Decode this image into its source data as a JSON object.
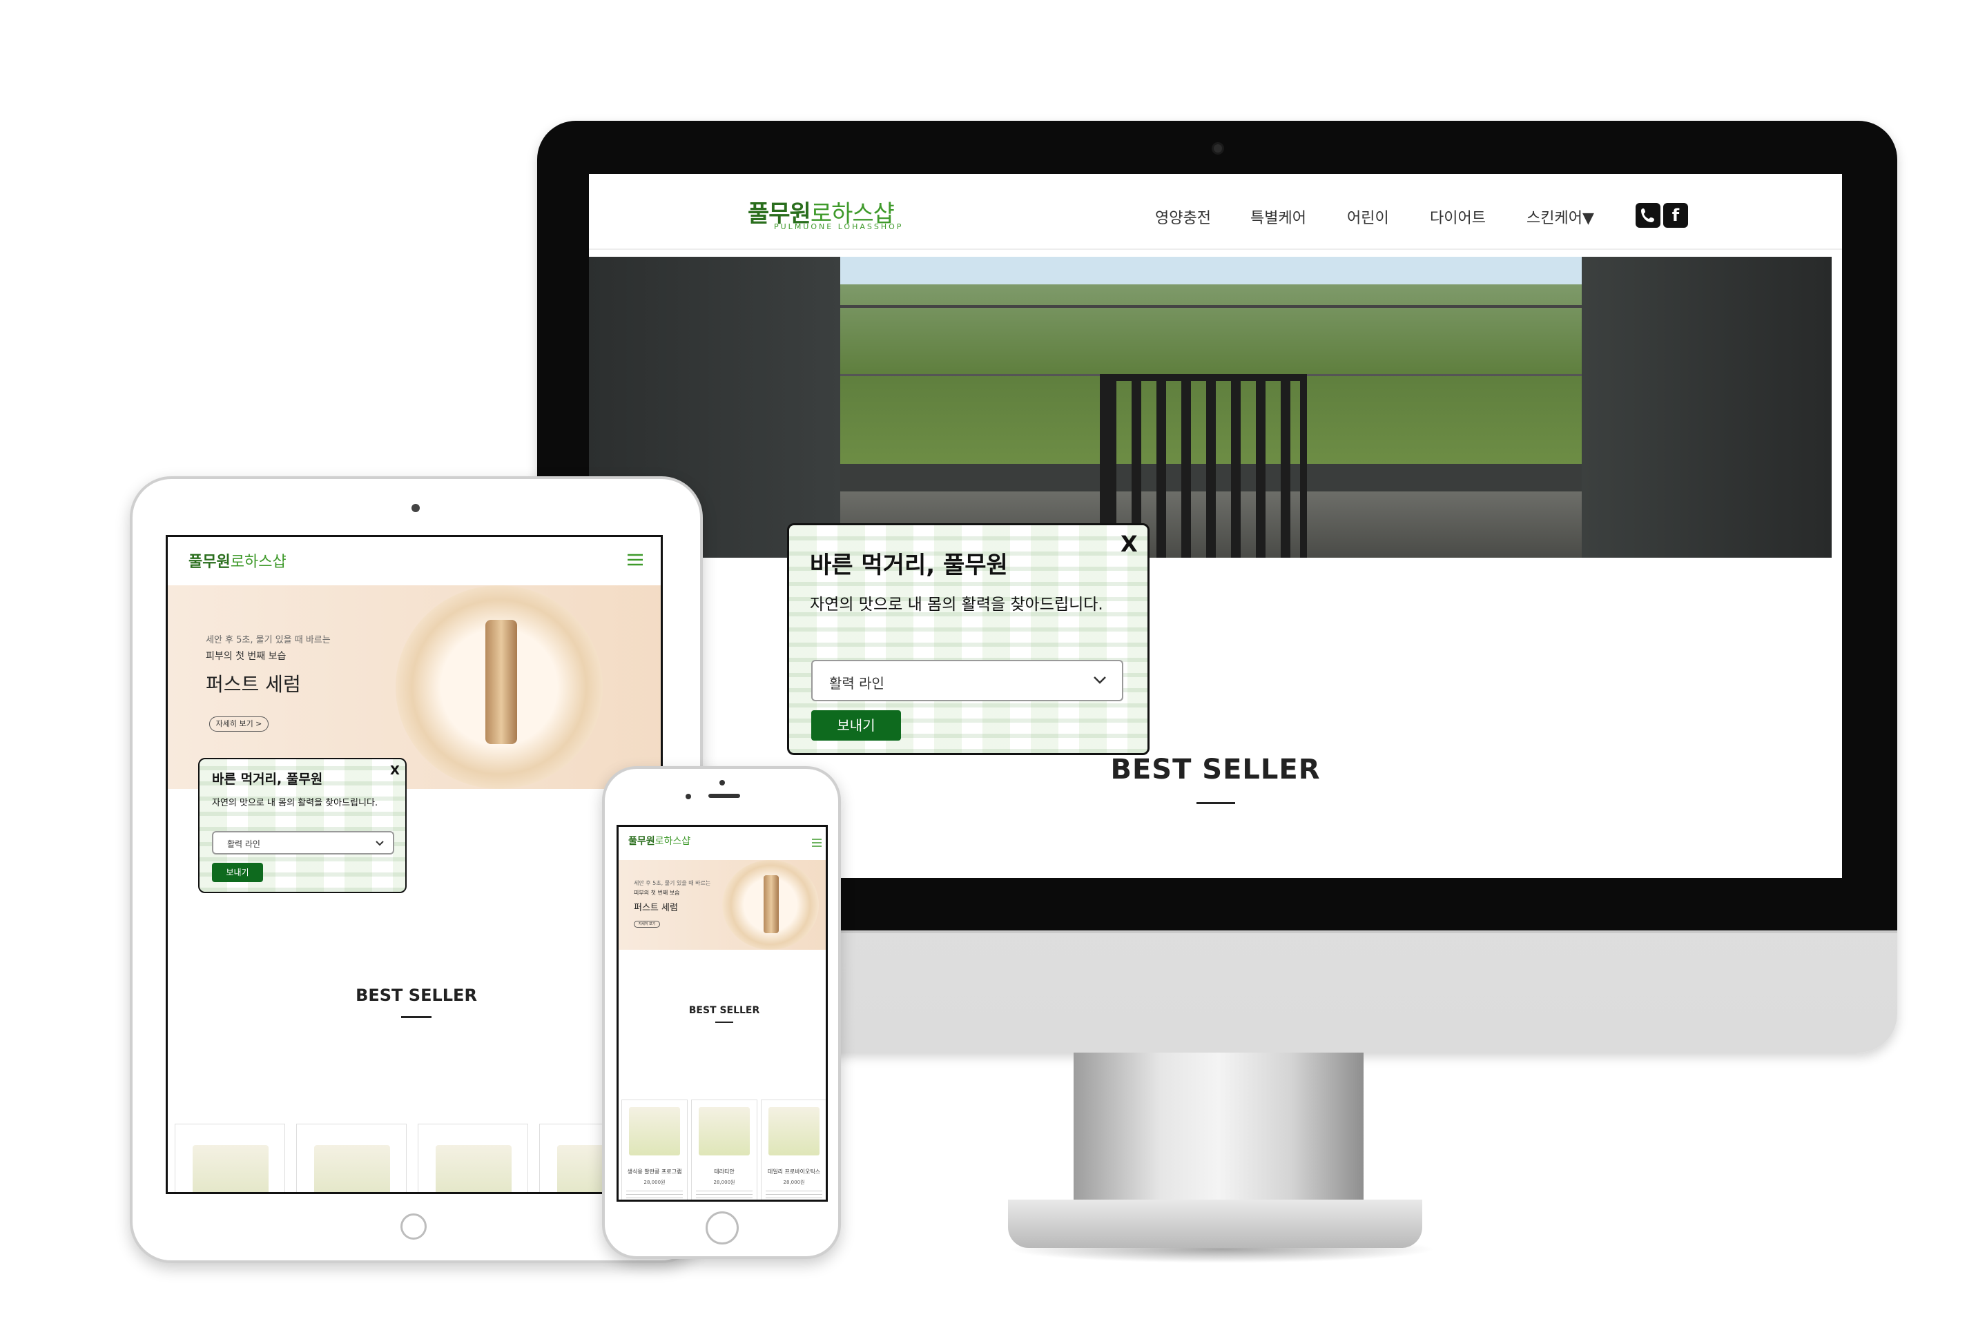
{
  "brand": {
    "logo_main": "풀무원",
    "logo_light": "로하스샵",
    "logo_sub": "PULMUONE LOHASSHOP",
    "color_primary": "#2a6e1d",
    "color_accent": "#3f9a2b",
    "color_button": "#0e6a1e"
  },
  "desktop": {
    "nav": [
      {
        "label": "영양충전"
      },
      {
        "label": "특별케어"
      },
      {
        "label": "어린이"
      },
      {
        "label": "다이어트"
      },
      {
        "label": "스킨케어▼"
      }
    ],
    "icons": {
      "phone": "phone-icon",
      "facebook": "facebook-icon",
      "facebook_glyph": "f"
    },
    "section_title": "BEST SELLER"
  },
  "popup": {
    "title": "바른 먹거리, 풀무원",
    "subtitle": "자연의 맛으로 내 몸의 활력을 찾아드립니다.",
    "close": "X",
    "select_value": "활력 라인",
    "submit": "보내기"
  },
  "tablet": {
    "hero": {
      "line1": "세안 후 5초, 물기 있을 때 바르는",
      "line2": "피부의 첫 번째 보습",
      "title": "퍼스트 세럼",
      "button": "자세히 보기 >"
    },
    "section_title": "BEST SELLER"
  },
  "phone": {
    "hero": {
      "line1": "세안 후 5초, 물기 있을 때 바르는",
      "line2": "피부의 첫 번째 보습",
      "title": "퍼스트 세럼",
      "button": "자세히 보기"
    },
    "section_title": "BEST SELLER",
    "products": [
      {
        "name": "생식용 발란콩 프로그램",
        "price": "28,000원"
      },
      {
        "name": "테라티안",
        "price": "28,000원"
      },
      {
        "name": "데일리 프로바이오틱스",
        "price": "28,000원"
      }
    ]
  }
}
